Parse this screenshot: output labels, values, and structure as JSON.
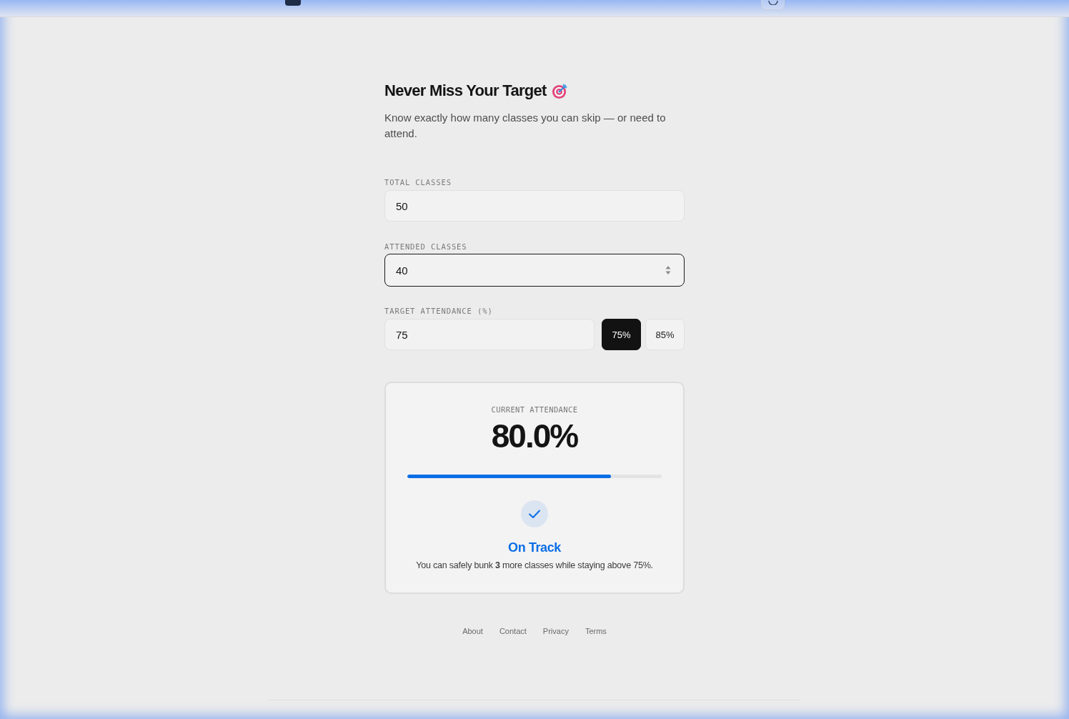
{
  "hero": {
    "title": "Never Miss Your Target",
    "subtitle": "Know exactly how many classes you can skip — or need to attend."
  },
  "form": {
    "fields": [
      {
        "label": "TOTAL CLASSES",
        "value": "50",
        "focused": false
      },
      {
        "label": "ATTENDED CLASSES",
        "value": "40",
        "focused": true
      }
    ],
    "target": {
      "label": "TARGET ATTENDANCE (%)",
      "value": "75",
      "presets": [
        {
          "label": "75%",
          "selected": true
        },
        {
          "label": "85%",
          "selected": false
        }
      ]
    }
  },
  "result": {
    "label": "CURRENT ATTENDANCE",
    "percentage": "80.0%",
    "progress": {
      "level": 0.8
    },
    "status": {
      "kind": "on_track",
      "title": "On Track",
      "message": "You can safely bunk **3** more classes while staying above 75%."
    }
  },
  "footer": {
    "links": [
      "About",
      "Contact",
      "Privacy",
      "Terms"
    ]
  }
}
